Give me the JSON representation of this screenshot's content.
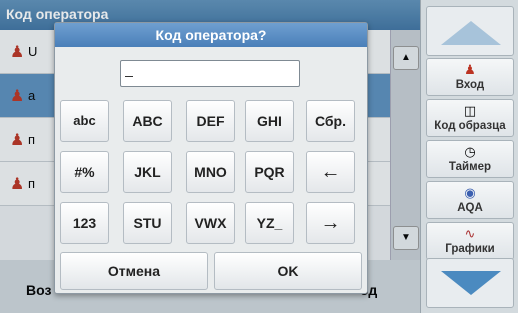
{
  "background": {
    "title": "Код оператора",
    "rows": [
      {
        "text": "U"
      },
      {
        "text": "a"
      },
      {
        "text": "п"
      },
      {
        "text": "п"
      }
    ],
    "bottom_left": "Воз",
    "bottom_right": "од"
  },
  "sidebar": {
    "items": [
      {
        "label": "Вход",
        "icon": "operator-icon"
      },
      {
        "label": "Код образца",
        "icon": "sample-vial-icon"
      },
      {
        "label": "Таймер",
        "icon": "timer-icon"
      },
      {
        "label": "AQA",
        "icon": "aqa-icon"
      },
      {
        "label": "Графики",
        "icon": "graph-icon"
      }
    ]
  },
  "dialog": {
    "title": "Код оператора?",
    "input_value": "",
    "keys": [
      [
        "abc",
        "ABC",
        "DEF",
        "GHI",
        "Сбр."
      ],
      [
        "#%",
        "JKL",
        "MNO",
        "PQR",
        "←"
      ],
      [
        "123",
        "STU",
        "VWX",
        "YZ_",
        "→"
      ]
    ],
    "cancel_label": "Отмена",
    "ok_label": "OK"
  }
}
